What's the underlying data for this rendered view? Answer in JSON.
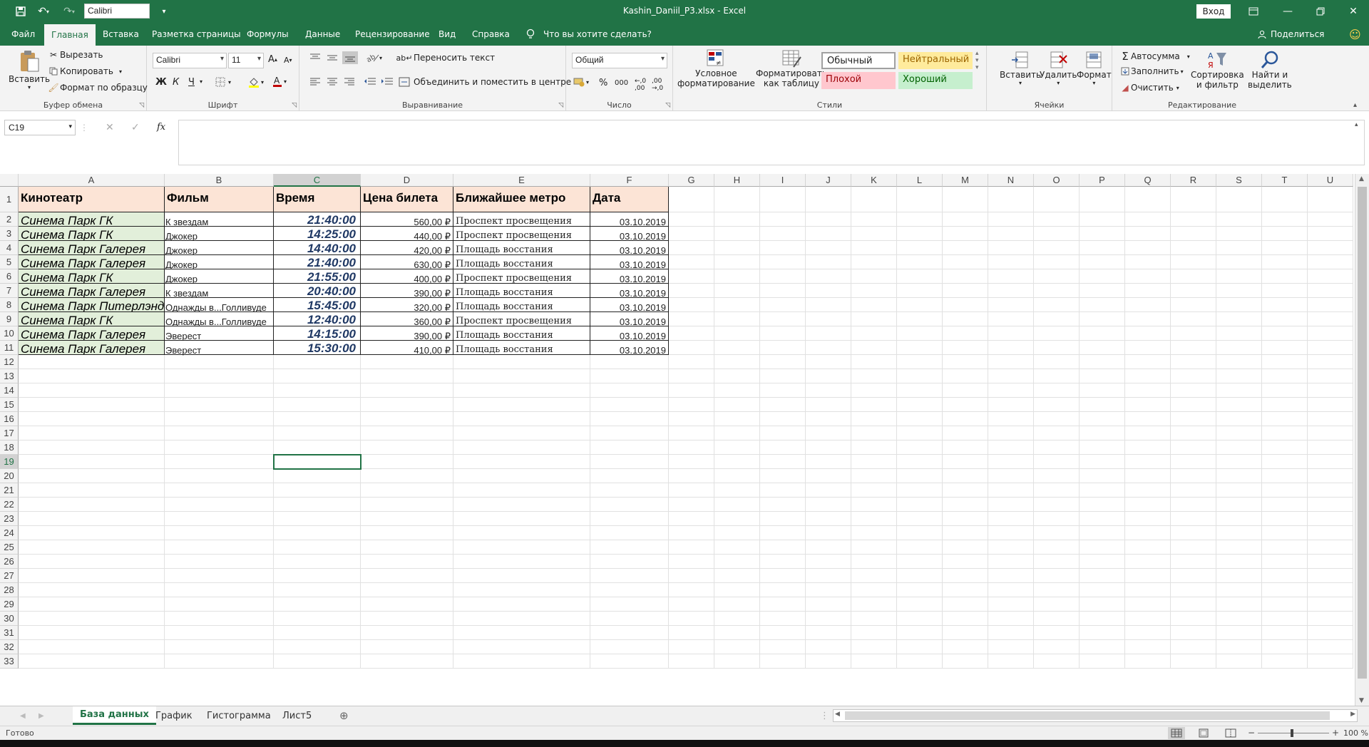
{
  "app": {
    "font_name": "Calibri",
    "window_title": "Kashin_Daniil_P3.xlsx  -  Excel",
    "login_label": "Вход",
    "colors": {
      "accent": "#217346",
      "header_fill": "#fce4d6",
      "a_fill": "#e2efda",
      "time_text": "#1f3864"
    }
  },
  "menu": {
    "tabs": [
      "Файл",
      "Главная",
      "Вставка",
      "Разметка страницы",
      "Формулы",
      "Данные",
      "Рецензирование",
      "Вид",
      "Справка"
    ],
    "tell_me": "Что вы хотите сделать?",
    "share": "Поделиться"
  },
  "ribbon": {
    "clipboard": {
      "paste": "Вставить",
      "cut": "Вырезать",
      "copy": "Копировать",
      "format_painter": "Формат по образцу",
      "label": "Буфер обмена"
    },
    "font": {
      "name": "Calibri",
      "size": "11",
      "bold": "Ж",
      "italic": "К",
      "underline": "Ч",
      "label": "Шрифт"
    },
    "alignment": {
      "wrap": "Переносить текст",
      "merge": "Объединить и поместить в центре",
      "label": "Выравнивание"
    },
    "number": {
      "format": "Общий",
      "percent": "%",
      "thousands": "000",
      "label": "Число"
    },
    "styles": {
      "conditional_1": "Условное",
      "conditional_2": "форматирование",
      "table_1": "Форматировать",
      "table_2": "как таблицу",
      "normal": "Обычный",
      "neutral": "Нейтральный",
      "bad": "Плохой",
      "good": "Хороший",
      "label": "Стили"
    },
    "cells": {
      "insert": "Вставить",
      "delete": "Удалить",
      "format": "Формат",
      "label": "Ячейки"
    },
    "editing": {
      "autosum": "Автосумма",
      "fill": "Заполнить",
      "clear": "Очистить",
      "sort_1": "Сортировка",
      "sort_2": "и фильтр",
      "find_1": "Найти и",
      "find_2": "выделить",
      "label": "Редактирование"
    }
  },
  "formula_bar": {
    "name_box": "C19",
    "fx": "fx",
    "formula": ""
  },
  "sheet": {
    "columns": [
      "A",
      "B",
      "C",
      "D",
      "E",
      "F",
      "G",
      "H",
      "I",
      "J",
      "K",
      "L",
      "M",
      "N",
      "O",
      "P",
      "Q",
      "R",
      "S",
      "T",
      "U"
    ],
    "selected_cell": "C19",
    "header": [
      "Кинотеатр",
      "Фильм",
      "Время",
      "Цена билета",
      "Ближайшее метро",
      "Дата"
    ],
    "rows": [
      [
        "Синема Парк  ГК",
        "К звездам",
        "21:40:00",
        "560,00 ₽",
        "Проспект просвещения",
        "03.10.2019"
      ],
      [
        "Синема Парк  ГК",
        "Джокер",
        "14:25:00",
        "440,00 ₽",
        "Проспект просвещения",
        "03.10.2019"
      ],
      [
        "Синема Парк  Галерея",
        "Джокер",
        "14:40:00",
        "420,00 ₽",
        "Площадь восстания",
        "03.10.2019"
      ],
      [
        "Синема Парк  Галерея",
        "Джокер",
        "21:40:00",
        "630,00 ₽",
        "Площадь восстания",
        "03.10.2019"
      ],
      [
        "Синема Парк  ГК",
        "Джокер",
        "21:55:00",
        "400,00 ₽",
        "Проспект просвещения",
        "03.10.2019"
      ],
      [
        "Синема Парк  Галерея",
        "К звездам",
        "20:40:00",
        "390,00 ₽",
        "Площадь восстания",
        "03.10.2019"
      ],
      [
        "Синема Парк  Питерлэнд",
        "Однажды в...Голливуде",
        "15:45:00",
        "320,00 ₽",
        "Площадь восстания",
        "03.10.2019"
      ],
      [
        "Синема Парк  ГК",
        "Однажды в...Голливуде",
        "12:40:00",
        "360,00 ₽",
        "Проспект просвещения",
        "03.10.2019"
      ],
      [
        "Синема Парк  Галерея",
        "Эверест",
        "14:15:00",
        "390,00 ₽",
        "Площадь восстания",
        "03.10.2019"
      ],
      [
        "Синема Парк  Галерея",
        "Эверест",
        "15:30:00",
        "410,00 ₽",
        "Площадь восстания",
        "03.10.2019"
      ]
    ]
  },
  "sheet_tabs": [
    "База данных",
    "График",
    "Гистограмма",
    "Лист5"
  ],
  "status": {
    "ready": "Готово",
    "zoom": "100 %"
  }
}
